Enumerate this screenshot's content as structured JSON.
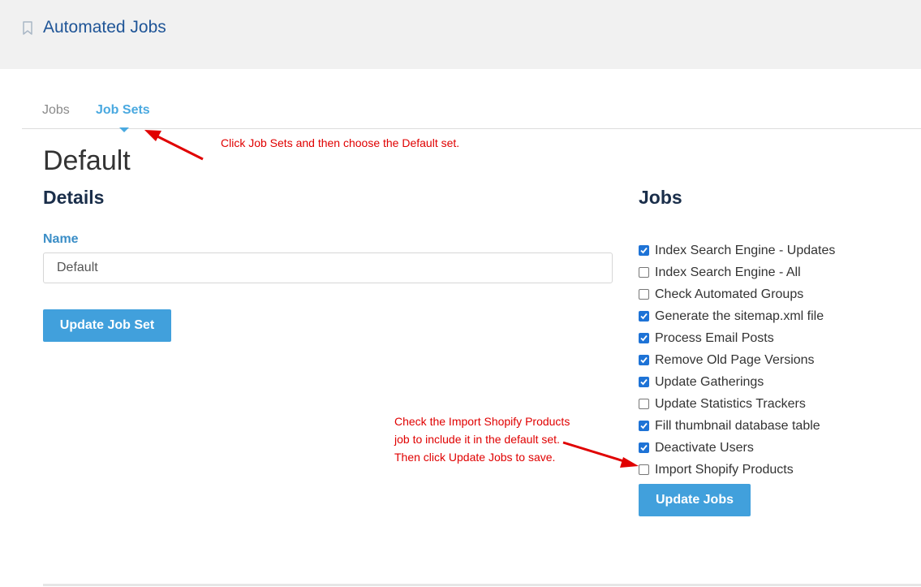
{
  "header": {
    "title": "Automated Jobs",
    "icon": "bookmark-icon"
  },
  "tabs": [
    {
      "label": "Jobs",
      "active": false
    },
    {
      "label": "Job Sets",
      "active": true
    }
  ],
  "page": {
    "title": "Default"
  },
  "details": {
    "heading": "Details",
    "name_label": "Name",
    "name_value": "Default",
    "update_button": "Update Job Set"
  },
  "jobs": {
    "heading": "Jobs",
    "items": [
      {
        "label": "Index Search Engine - Updates",
        "checked": true
      },
      {
        "label": "Index Search Engine - All",
        "checked": false
      },
      {
        "label": "Check Automated Groups",
        "checked": false
      },
      {
        "label": "Generate the sitemap.xml file",
        "checked": true
      },
      {
        "label": "Process Email Posts",
        "checked": true
      },
      {
        "label": "Remove Old Page Versions",
        "checked": true
      },
      {
        "label": "Update Gatherings",
        "checked": true
      },
      {
        "label": "Update Statistics Trackers",
        "checked": false
      },
      {
        "label": "Fill thumbnail database table",
        "checked": true
      },
      {
        "label": "Deactivate Users",
        "checked": true
      },
      {
        "label": "Import Shopify Products",
        "checked": false
      }
    ],
    "update_button": "Update Jobs"
  },
  "annotations": {
    "tab_note": "Click Job Sets and then choose the Default set.",
    "import_note_lines": [
      "Check the Import Shopify Products",
      "job to include it in the default set.",
      "Then click Update Jobs to save."
    ]
  },
  "colors": {
    "accent": "#41a0dc",
    "active_tab": "#4aa9e0",
    "annotation": "#e00000",
    "checkbox_checked": "#1e73d6"
  }
}
